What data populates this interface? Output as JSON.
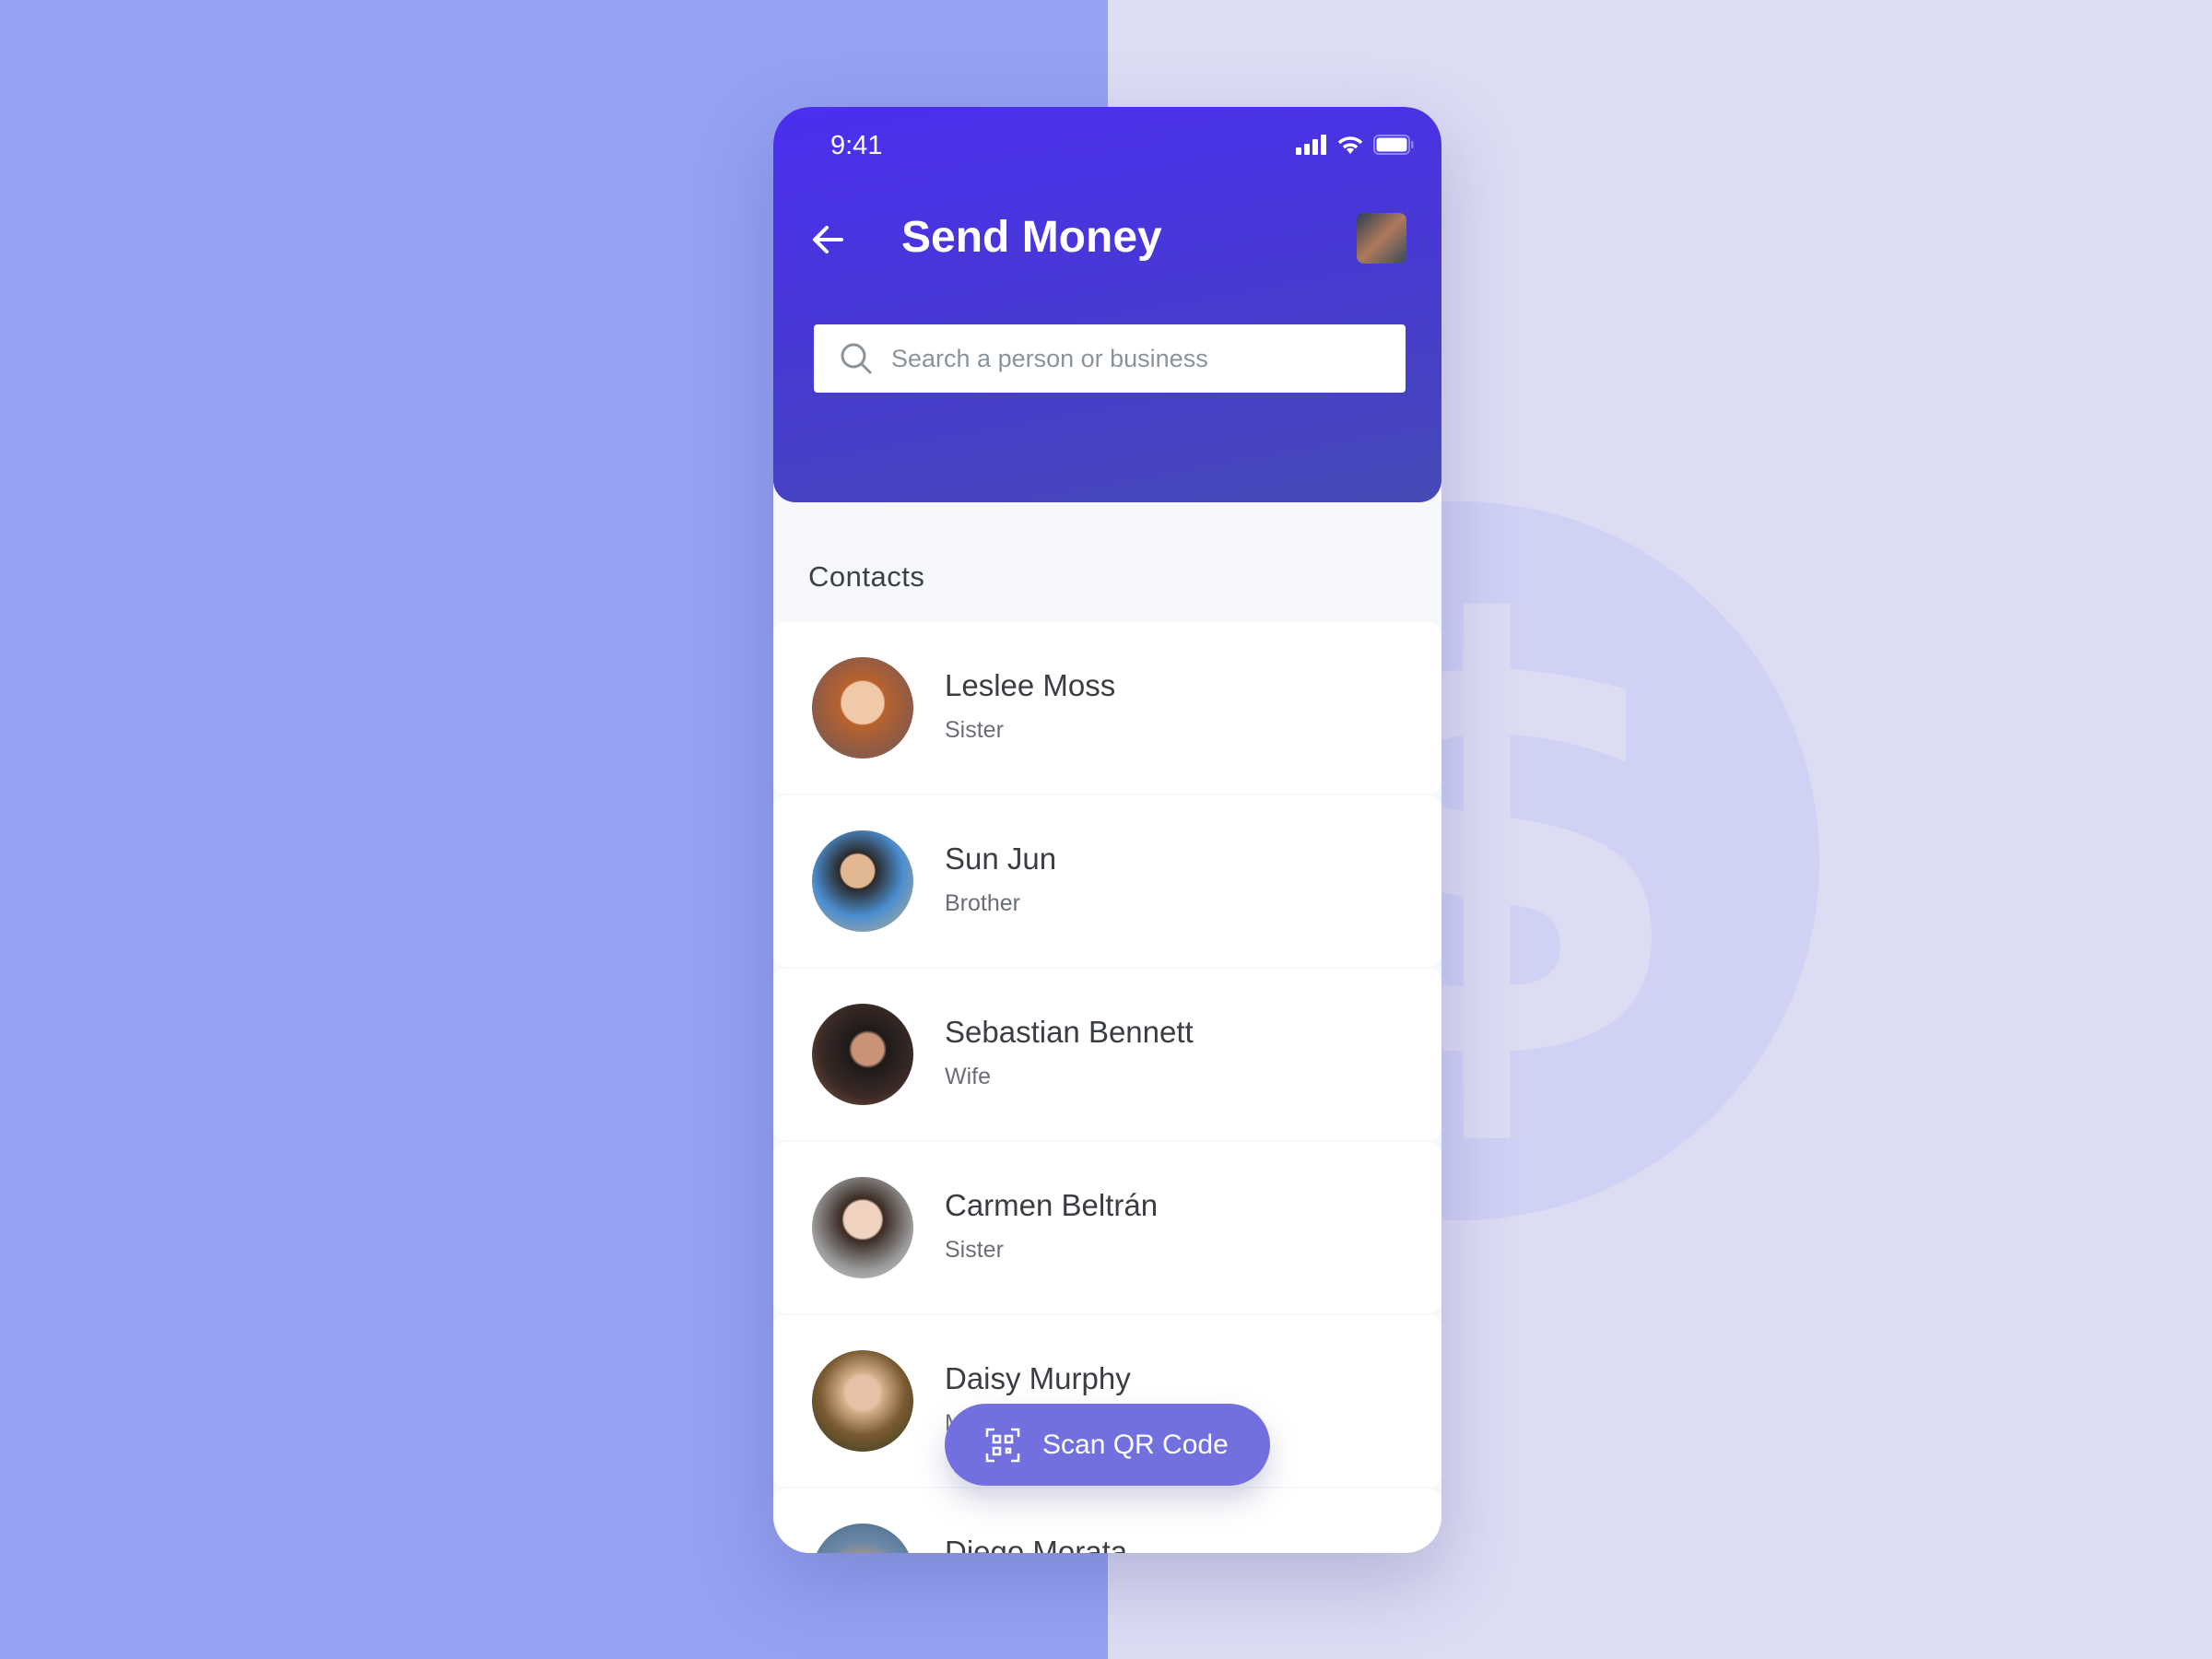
{
  "status_bar": {
    "time": "9:41",
    "icons": [
      "signal-icon",
      "wifi-icon",
      "battery-icon"
    ]
  },
  "header": {
    "title": "Send Money",
    "back_icon": "arrow-left-icon"
  },
  "search": {
    "placeholder": "Search a person or business"
  },
  "contacts": {
    "label": "Contacts",
    "items": [
      {
        "name": "Leslee Moss",
        "relation": "Sister"
      },
      {
        "name": "Sun Jun",
        "relation": "Brother"
      },
      {
        "name": "Sebastian Bennett",
        "relation": "Wife"
      },
      {
        "name": "Carmen Beltrán",
        "relation": "Sister"
      },
      {
        "name": "Daisy Murphy",
        "relation": "M"
      },
      {
        "name": "Diego Morata",
        "relation": ""
      }
    ]
  },
  "fab": {
    "label": "Scan QR Code",
    "icon": "qr-scan-icon"
  },
  "colors": {
    "primary": "#4a2ff0",
    "fab": "#7270df",
    "bg_left": "#95a2f1",
    "bg_right": "#dcdcf3"
  }
}
